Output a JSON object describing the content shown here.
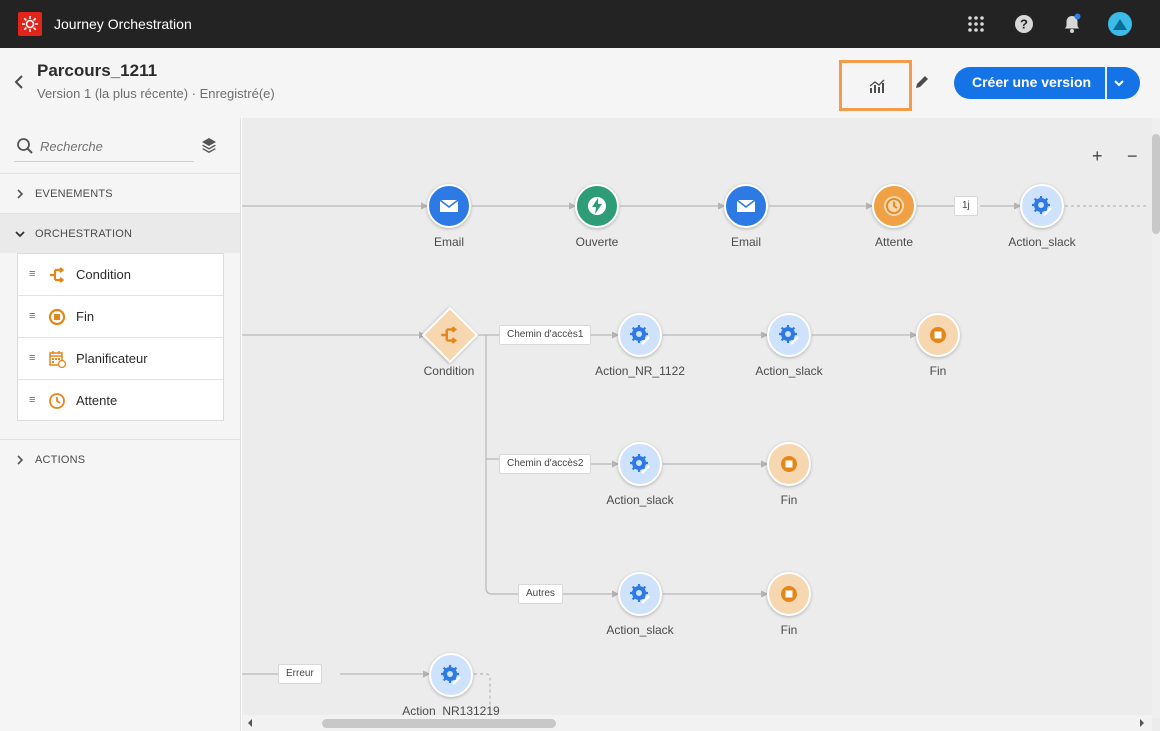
{
  "topbar": {
    "app_title": "Journey Orchestration",
    "icons": [
      "apps-grid-icon",
      "help-icon",
      "notifications-bell-icon",
      "user-avatar-icon"
    ]
  },
  "header": {
    "title": "Parcours_1211",
    "subtitle": "Version 1 (la plus récente) · Enregistré(e)",
    "cta_label": "Créer une version"
  },
  "sidebar": {
    "search_placeholder": "Recherche",
    "sections": {
      "events": "EVENEMENTS",
      "orchestration": "ORCHESTRATION",
      "actions": "ACTIONS"
    },
    "items": [
      {
        "label": "Condition",
        "icon": "condition-icon"
      },
      {
        "label": "Fin",
        "icon": "end-icon"
      },
      {
        "label": "Planificateur",
        "icon": "scheduler-icon"
      },
      {
        "label": "Attente",
        "icon": "wait-icon"
      }
    ]
  },
  "canvas": {
    "zoom_in": "+",
    "zoom_out": "−",
    "row1": [
      "Email",
      "Ouverte",
      "Email",
      "Attente",
      "Action_slack"
    ],
    "row1_pill": "1j",
    "condition": "Condition",
    "paths": [
      "Chemin d'accès1",
      "Chemin d'accès2",
      "Autres"
    ],
    "path1_nodes": [
      "Action_NR_1122",
      "Action_slack",
      "Fin"
    ],
    "path2_nodes": [
      "Action_slack",
      "Fin"
    ],
    "path3_nodes": [
      "Action_slack",
      "Fin"
    ],
    "error_pill": "Erreur",
    "error_node": "Action_NR131219"
  },
  "colors": {
    "accent": "#1473e6",
    "highlight_border": "#f29b4a",
    "topbar": "#232323"
  }
}
